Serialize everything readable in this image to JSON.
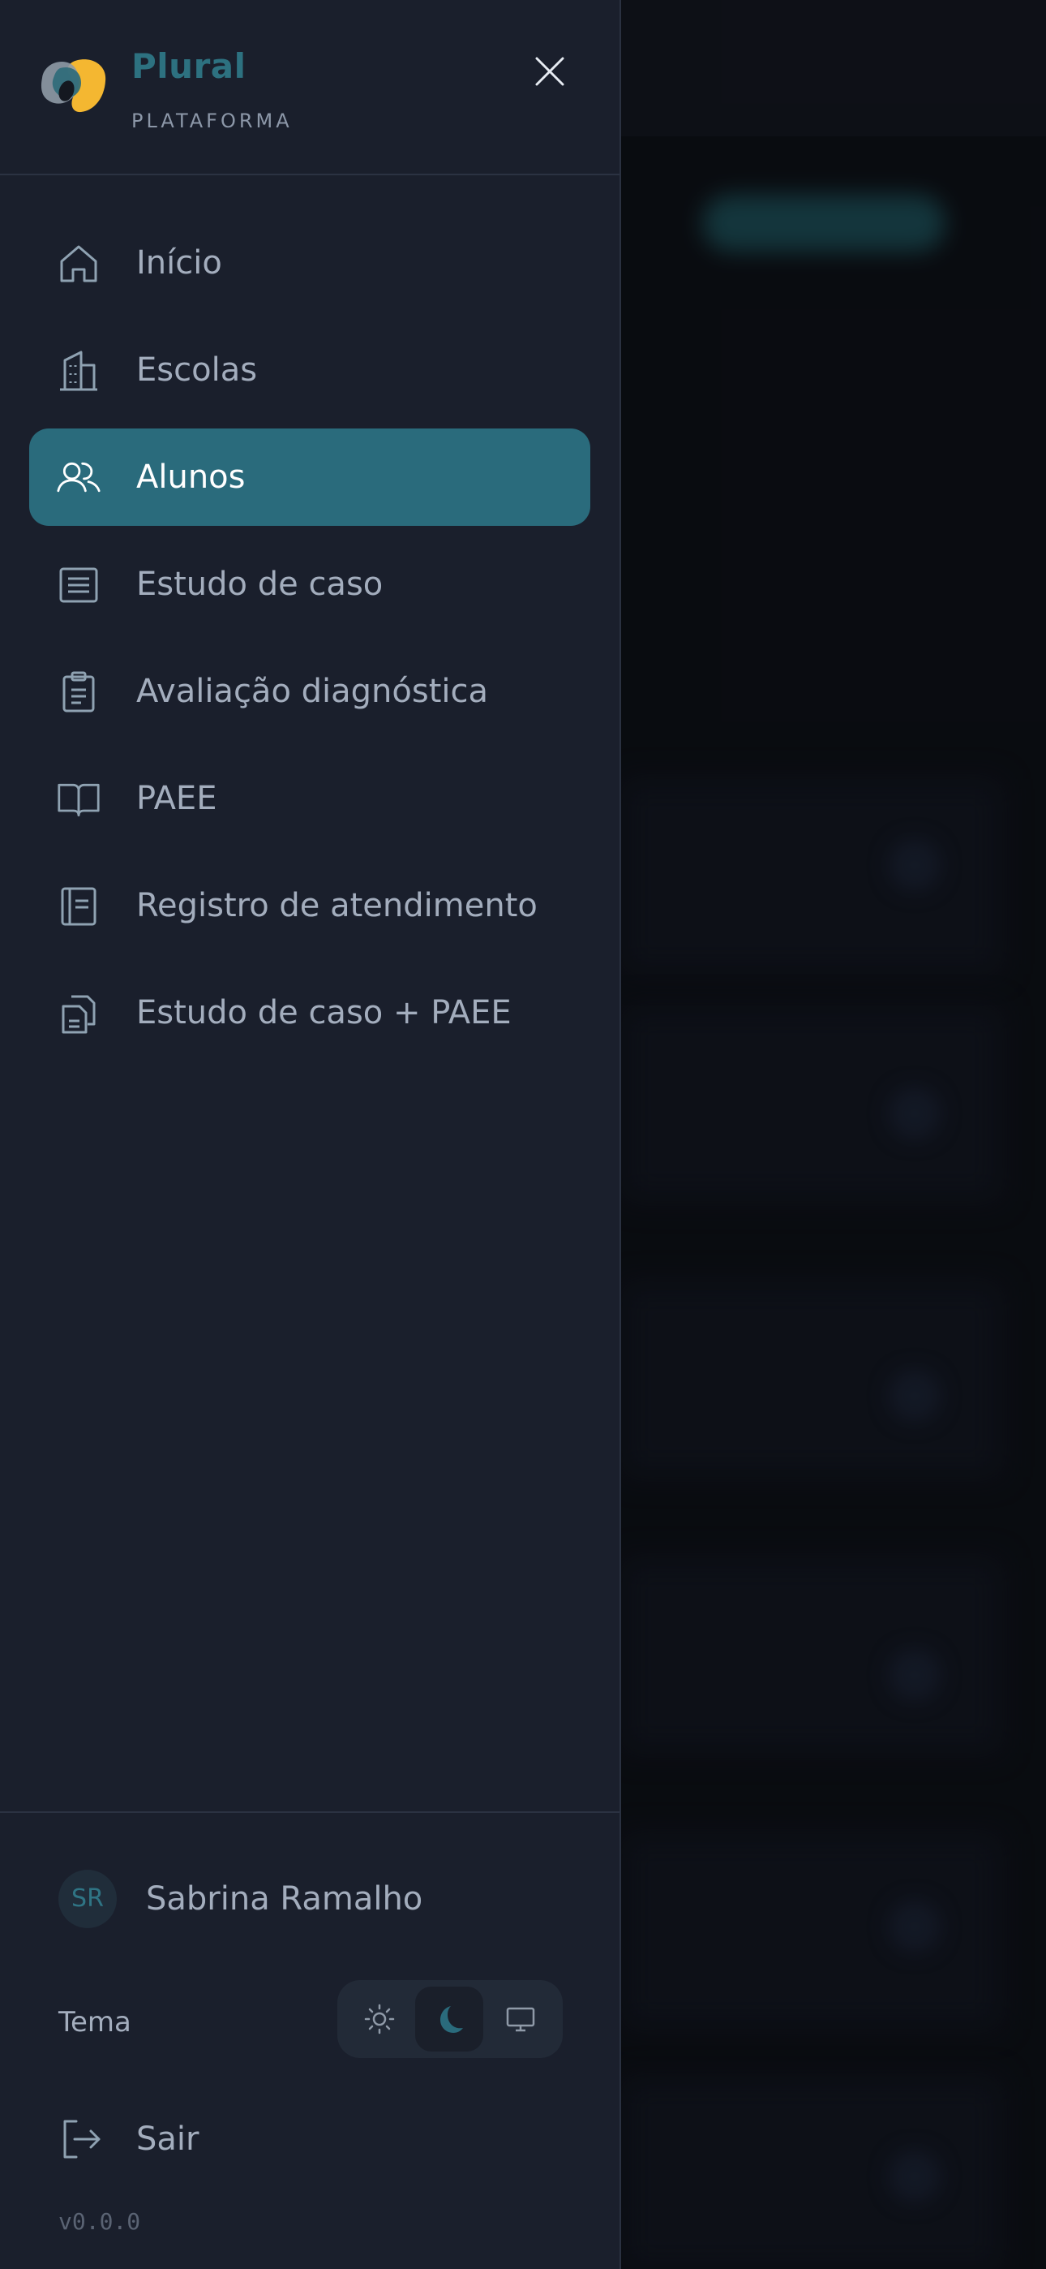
{
  "brand": {
    "name": "Plural",
    "subtitle": "PLATAFORMA"
  },
  "nav": {
    "items": [
      {
        "label": "Início",
        "icon": "home-icon",
        "active": false
      },
      {
        "label": "Escolas",
        "icon": "building-icon",
        "active": false
      },
      {
        "label": "Alunos",
        "icon": "users-icon",
        "active": true
      },
      {
        "label": "Estudo de caso",
        "icon": "list-document-icon",
        "active": false
      },
      {
        "label": "Avaliação diagnóstica",
        "icon": "clipboard-icon",
        "active": false
      },
      {
        "label": "PAEE",
        "icon": "open-book-icon",
        "active": false
      },
      {
        "label": "Registro de atendimento",
        "icon": "notebook-icon",
        "active": false
      },
      {
        "label": "Estudo de caso + PAEE",
        "icon": "documents-icon",
        "active": false
      }
    ]
  },
  "user": {
    "initials": "SR",
    "name": "Sabrina Ramalho"
  },
  "theme": {
    "label": "Tema",
    "options": [
      "light",
      "dark",
      "system"
    ],
    "selected": "dark"
  },
  "signout": {
    "label": "Sair"
  },
  "version": "v0.0.0",
  "colors": {
    "drawer_bg": "#1a1f2c",
    "accent": "#2a6b7c",
    "brand_text": "#2d7180",
    "logo_yellow": "#f4b731",
    "text_muted": "#a3adbd"
  }
}
